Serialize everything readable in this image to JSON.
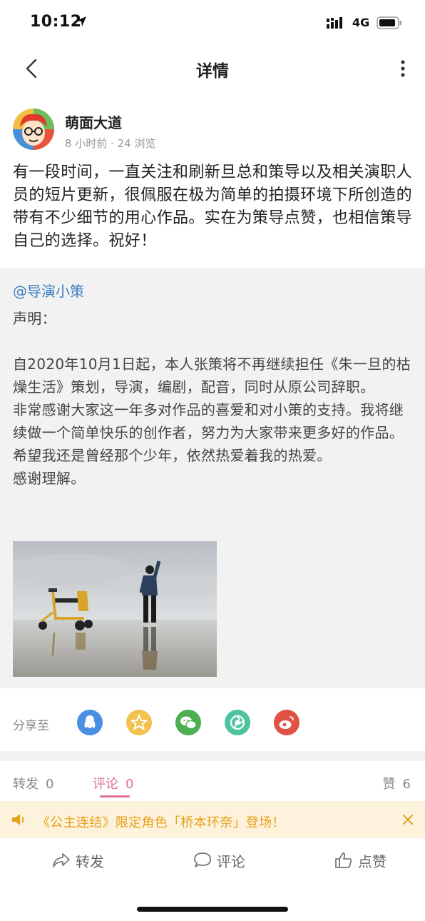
{
  "status_bar": {
    "time": "10:12",
    "network": "4G"
  },
  "nav": {
    "title": "详情"
  },
  "author": {
    "name": "萌面大道",
    "meta": "8 小时前 · 24 浏览"
  },
  "post": {
    "text": "有一段时间，一直关注和刷新旦总和策导以及相关演职人员的短片更新，很佩服在极为简单的拍摄环境下所创造的带有不少细节的用心作品。实在为策导点赞，也相信策导自己的选择。祝好！"
  },
  "quote": {
    "mention": "@导演小策",
    "body": "声明：\n\n自2020年10月1日起，本人张策将不再继续担任《朱一旦的枯燥生活》策划，导演，编剧，配音，同时从原公司辞职。\n非常感谢大家这一年多对作品的喜爱和对小策的支持。我将继续做一个简单快乐的创作者，努力为大家带来更多好的作品。\n希望我还是曾经那个少年，依然热爱着我的热爱。\n感谢理解。"
  },
  "share": {
    "label": "分享至",
    "targets": [
      {
        "icon": "qq-icon",
        "color": "#4a90e2"
      },
      {
        "icon": "qzone-icon",
        "color": "#f2c14e"
      },
      {
        "icon": "wechat-icon",
        "color": "#4caf50"
      },
      {
        "icon": "moments-icon",
        "color": "#4ec3a0"
      },
      {
        "icon": "weibo-icon",
        "color": "#e05244"
      }
    ]
  },
  "tabs": {
    "repost": {
      "label": "转发",
      "count": "0"
    },
    "comment": {
      "label": "评论",
      "count": "0"
    },
    "like": {
      "label": "赞",
      "count": "6"
    }
  },
  "announcement": {
    "text": "《公主连结》限定角色「桥本环奈」登场！"
  },
  "actions": {
    "repost": "转发",
    "comment": "评论",
    "like": "点赞"
  },
  "colors": {
    "accent": "#e0709a",
    "link": "#3b7fc4",
    "notice": "#e6a01c",
    "notice_bg": "#fdf3dc"
  }
}
